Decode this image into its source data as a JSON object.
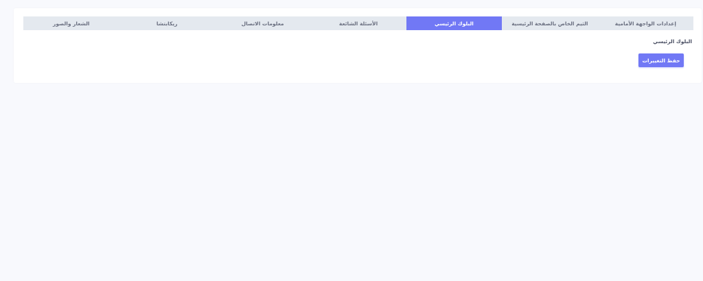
{
  "tabs": [
    {
      "label": "إعدادات الواجهة الأمامية",
      "active": false
    },
    {
      "label": "الثيم الخاص بالصفحة الرئيسية",
      "active": false
    },
    {
      "label": "البلوك الرئيسي",
      "active": true
    },
    {
      "label": "الأسئلة الشائعة",
      "active": false
    },
    {
      "label": "معلومات الاتصال",
      "active": false
    },
    {
      "label": "ريكابتشا",
      "active": false
    },
    {
      "label": "الشعار والصور",
      "active": false
    }
  ],
  "section": {
    "title": "البلوك الرئيسي"
  },
  "actions": {
    "save_label": "حفظ التغييرات"
  },
  "colors": {
    "accent": "#7178f5",
    "tab_bar_bg": "#e4e9ef",
    "page_bg": "#f8f9fd"
  }
}
